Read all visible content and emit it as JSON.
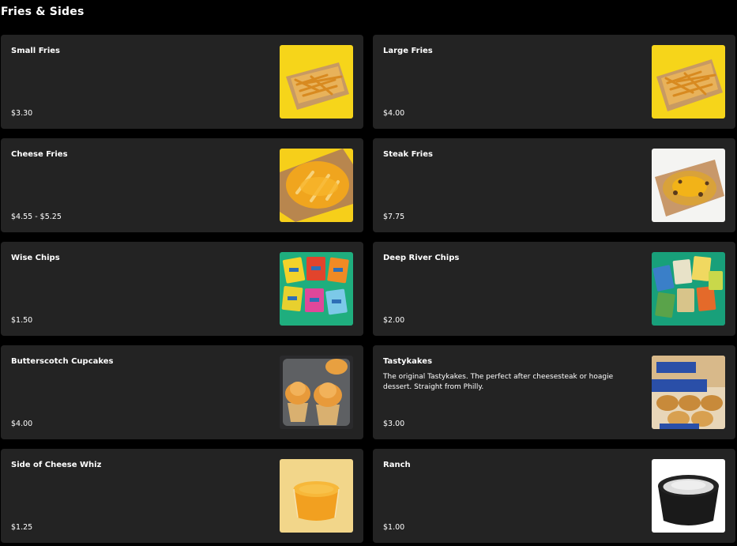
{
  "section": {
    "title": "Fries & Sides"
  },
  "items": [
    {
      "name": "Small Fries",
      "description": "",
      "price": "$3.30",
      "icon": "fries-icon"
    },
    {
      "name": "Large Fries",
      "description": "",
      "price": "$4.00",
      "icon": "fries-icon"
    },
    {
      "name": "Cheese Fries",
      "description": "",
      "price": "$4.55 - $5.25",
      "icon": "cheese-fries-icon"
    },
    {
      "name": "Steak Fries",
      "description": "",
      "price": "$7.75",
      "icon": "steak-fries-icon"
    },
    {
      "name": "Wise Chips",
      "description": "",
      "price": "$1.50",
      "icon": "chips-bags-icon"
    },
    {
      "name": "Deep River Chips",
      "description": "",
      "price": "$2.00",
      "icon": "chips-bags-icon"
    },
    {
      "name": "Butterscotch Cupcakes",
      "description": "",
      "price": "$4.00",
      "icon": "cupcakes-icon"
    },
    {
      "name": "Tastykakes",
      "description": "The original Tastykakes. The perfect after cheesesteak or hoagie dessert. Straight from Philly.",
      "price": "$3.00",
      "icon": "tastykakes-icon"
    },
    {
      "name": "Side of Cheese Whiz",
      "description": "",
      "price": "$1.25",
      "icon": "cheese-cup-icon"
    },
    {
      "name": "Ranch",
      "description": "",
      "price": "$1.00",
      "icon": "ranch-cup-icon"
    }
  ],
  "colors": {
    "background": "#000000",
    "card": "#232323",
    "text": "#ffffff"
  }
}
